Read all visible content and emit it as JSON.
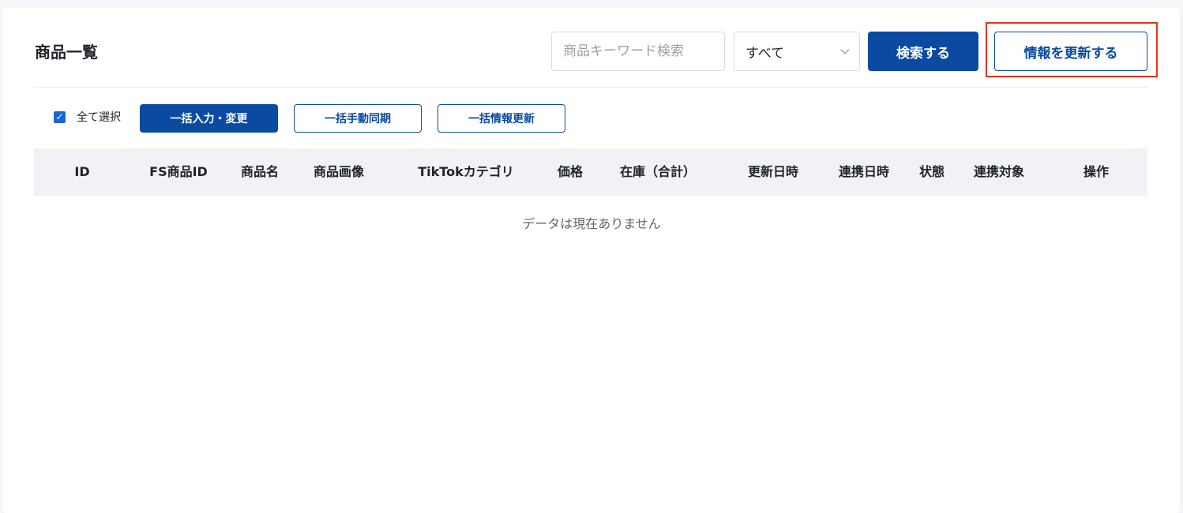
{
  "header": {
    "title": "商品一覧",
    "search_placeholder": "商品キーワード検索",
    "filter_selected": "すべて",
    "search_button": "検索する",
    "update_button": "情報を更新する"
  },
  "toolbar": {
    "select_all_label": "全て選択",
    "select_all_checked": true,
    "bulk_edit_button": "一括入力・変更",
    "bulk_sync_button": "一括手動同期",
    "bulk_info_update_button": "一括情報更新"
  },
  "table": {
    "columns": [
      "ID",
      "FS商品ID",
      "商品名",
      "商品画像",
      "TikTokカテゴリ",
      "価格",
      "在庫（合計）",
      "更新日時",
      "連携日時",
      "状態",
      "連携対象",
      "操作"
    ],
    "empty_message": "データは現在ありません"
  },
  "colors": {
    "primary": "#0a4aa0",
    "highlight_border": "#e8321e",
    "header_bg": "#f0f2f5"
  }
}
